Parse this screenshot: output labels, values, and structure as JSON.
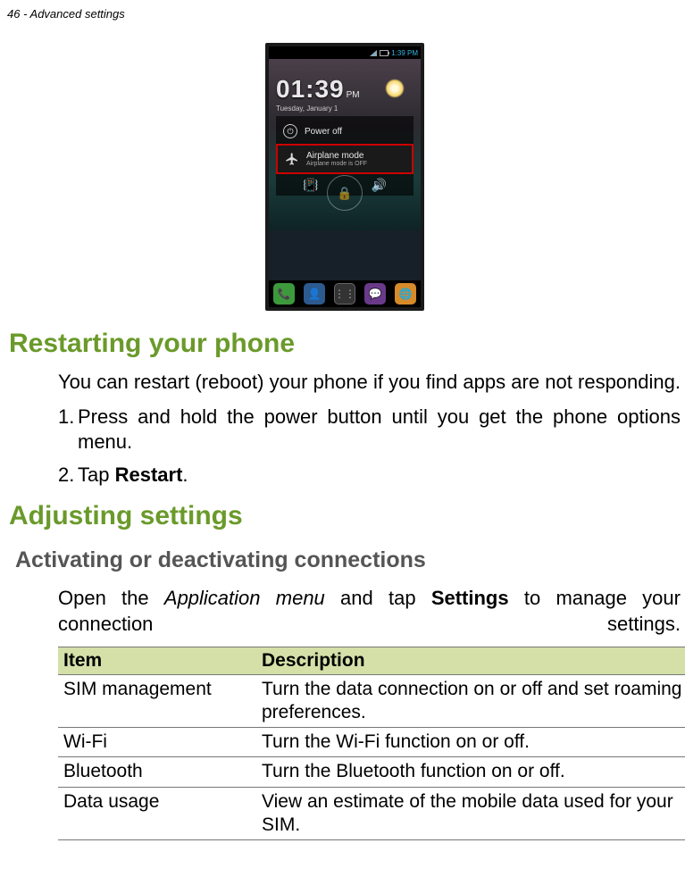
{
  "page_header": "46 - Advanced settings",
  "phone": {
    "status_time": "1:39 PM",
    "clock_time": "01:39",
    "clock_ampm": "PM",
    "clock_date": "Tuesday, January 1",
    "menu": {
      "power_off": "Power off",
      "airplane_title": "Airplane mode",
      "airplane_sub": "Airplane mode is OFF"
    }
  },
  "section1": {
    "heading": "Restarting your phone",
    "intro": "You can restart (reboot) your phone if you find apps are not responding.",
    "step1": "Press and hold the power button until you get the phone options menu.",
    "step2_prefix": "Tap ",
    "step2_bold": "Restart",
    "step2_suffix": "."
  },
  "section2": {
    "heading": "Adjusting settings",
    "subheading": "Activating or deactivating connections",
    "intro_part1": "Open the ",
    "intro_italic": "Application menu",
    "intro_part2": " and tap ",
    "intro_bold": "Settings",
    "intro_part3": " to manage your connection settings."
  },
  "table": {
    "headers": {
      "col1": "Item",
      "col2": "Description"
    },
    "rows": [
      {
        "item": "SIM management",
        "desc": "Turn the data connection on or off and set roaming preferences."
      },
      {
        "item": "Wi-Fi",
        "desc": "Turn the Wi-Fi function on or off."
      },
      {
        "item": "Bluetooth",
        "desc": "Turn the Bluetooth function on or off."
      },
      {
        "item": "Data usage",
        "desc": "View an estimate of the mobile data used for your SIM."
      }
    ]
  }
}
